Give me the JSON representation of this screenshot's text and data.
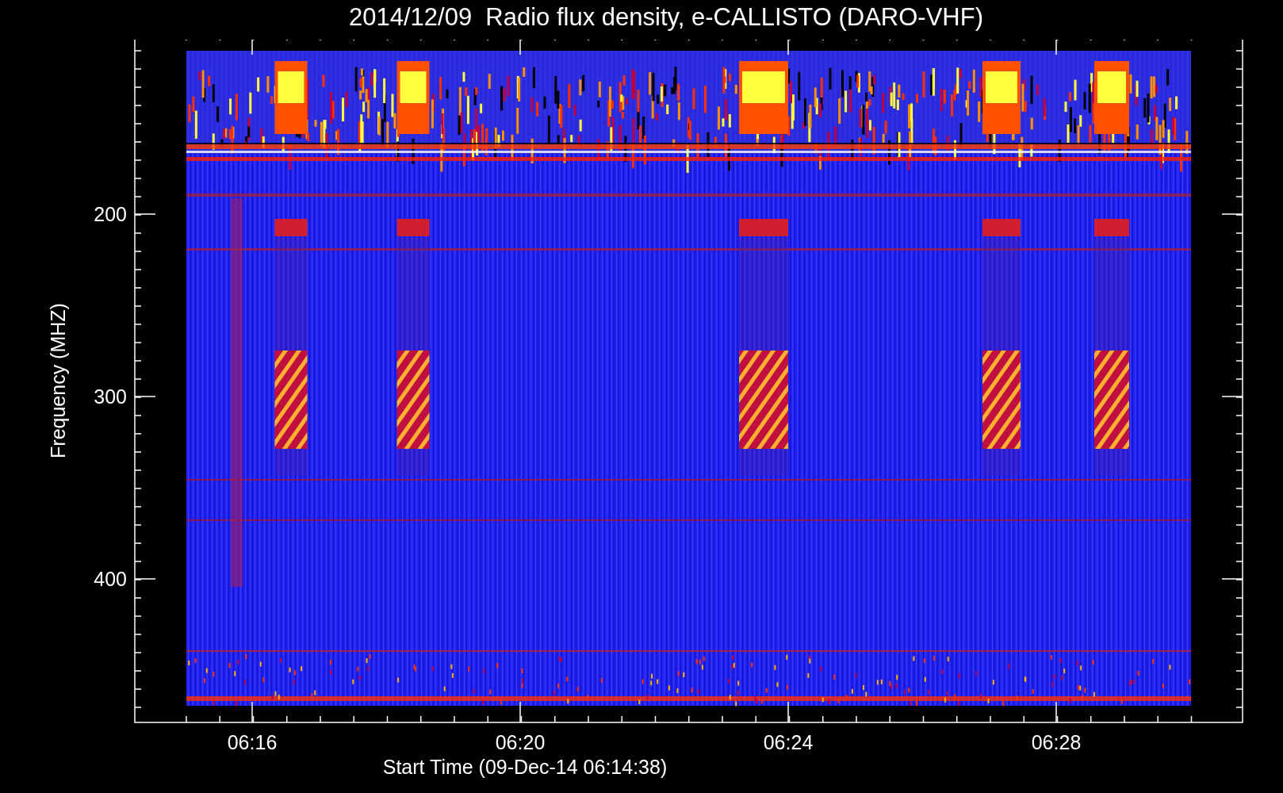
{
  "title": "2014/12/09  Radio flux density, e-CALLISTO (DARO-VHF)",
  "y_axis": {
    "label": "Frequency (MHZ)",
    "ticks": [
      "200",
      "300",
      "400"
    ]
  },
  "x_axis": {
    "label": "Start Time (09-Dec-14 06:14:38)",
    "ticks": [
      "06:16",
      "06:20",
      "06:24",
      "06:28"
    ]
  }
}
